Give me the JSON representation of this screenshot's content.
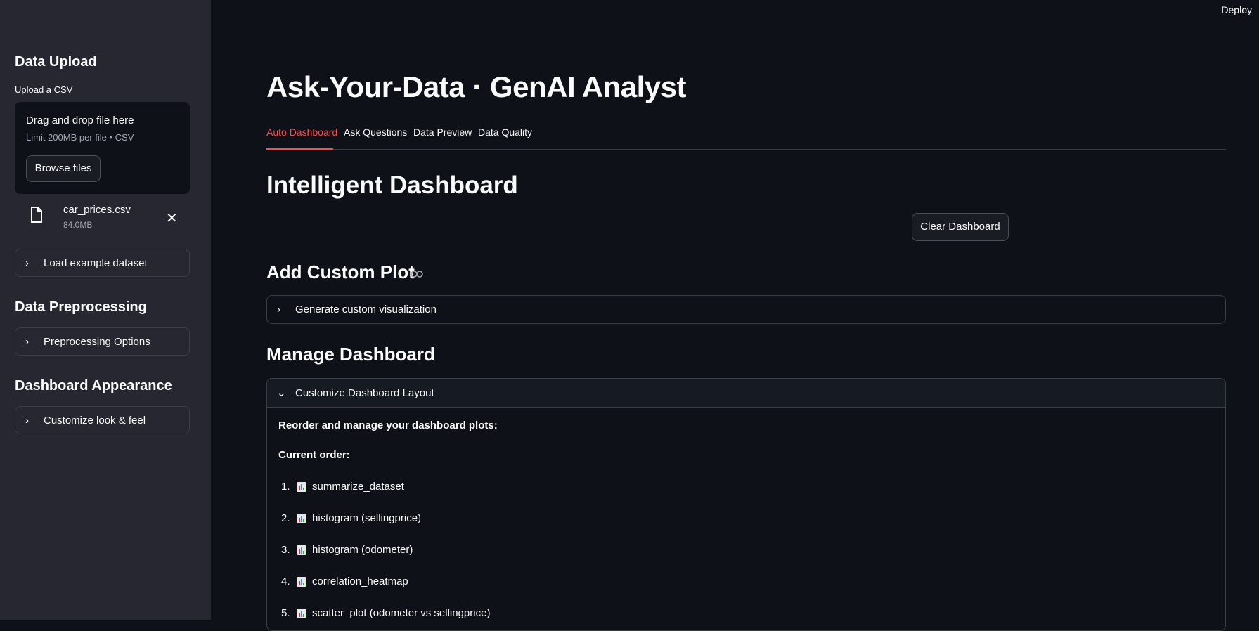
{
  "header": {
    "deploy_label": "Deploy"
  },
  "sidebar": {
    "upload_heading": "Data Upload",
    "upload_label": "Upload a CSV",
    "dropzone_title": "Drag and drop file here",
    "dropzone_limit": "Limit 200MB per file • CSV",
    "browse_label": "Browse files",
    "file_name": "car_prices.csv",
    "file_size": "84.0MB",
    "example_label": "Load example dataset",
    "preprocessing_heading": "Data Preprocessing",
    "preprocessing_label": "Preprocessing Options",
    "appearance_heading": "Dashboard Appearance",
    "appearance_label": "Customize look & feel"
  },
  "main": {
    "title": "Ask-Your-Data · GenAI Analyst",
    "tabs": [
      "Auto Dashboard",
      "Ask Questions",
      "Data Preview",
      "Data Quality"
    ],
    "dashboard_heading": "Intelligent Dashboard",
    "clear_label": "Clear Dashboard",
    "custom_plot_heading": "Add Custom Plot",
    "custom_plot_expander": "Generate custom visualization",
    "manage_heading": "Manage Dashboard",
    "manage_expander": "Customize Dashboard Layout",
    "reorder_text": "Reorder and manage your dashboard plots:",
    "current_order_label": "Current order:",
    "order_items": [
      {
        "num": "1.",
        "label": "summarize_dataset"
      },
      {
        "num": "2.",
        "label": "histogram (sellingprice)"
      },
      {
        "num": "3.",
        "label": "histogram (odometer)"
      },
      {
        "num": "4.",
        "label": "correlation_heatmap"
      },
      {
        "num": "5.",
        "label": "scatter_plot (odometer vs sellingprice)"
      }
    ]
  },
  "colors": {
    "accent": "#ff4b4b",
    "background": "#0e1117",
    "sidebar": "#262730"
  }
}
